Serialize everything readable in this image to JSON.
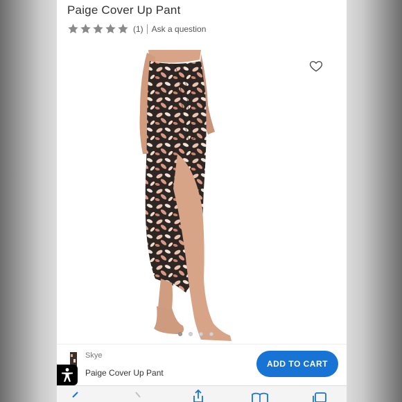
{
  "product": {
    "title": "Paige Cover Up Pant",
    "rating_count": "(1)",
    "ask_question": "Ask a question",
    "star_color": "#8a8a8a"
  },
  "gallery": {
    "dots_total": 4,
    "active_dot": 1
  },
  "sticky_bar": {
    "brand": "Skye",
    "product_name": "Paige Cover Up Pant",
    "add_to_cart": "ADD TO CART",
    "button_color": "#1773d4"
  },
  "icons": {
    "wishlist": "heart-outline-icon",
    "accessibility": "accessibility-icon",
    "back": "back-arrow-icon",
    "forward": "forward-arrow-icon",
    "share": "share-icon",
    "bookmarks": "bookmarks-icon",
    "tabs": "tabs-icon"
  }
}
